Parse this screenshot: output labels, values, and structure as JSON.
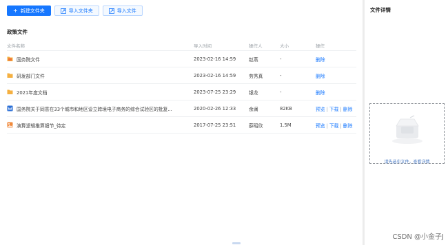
{
  "toolbar": {
    "new_folder": "新建文件夹",
    "import_folder": "导入文件夹",
    "import_file": "导入文件"
  },
  "section": {
    "title": "政策文件"
  },
  "table": {
    "headers": {
      "name": "文件名称",
      "time": "导入时间",
      "operator": "操作人",
      "size": "大小",
      "action": "操作"
    },
    "rows": [
      {
        "name": "国务院文件",
        "time": "2023-02-16 14:59",
        "operator": "赵燕",
        "size": "-",
        "icon": "folder-special-icon"
      },
      {
        "name": "研发部门文件",
        "time": "2023-02-16 14:59",
        "operator": "劳秀真",
        "size": "-",
        "icon": "folder-icon"
      },
      {
        "name": "2021年度文档",
        "time": "2023-07-25 23:29",
        "operator": "银龙",
        "size": "-",
        "icon": "folder-icon"
      },
      {
        "name": "国务院关于同意在33个城市和地区设立跨境电子商务的综合试验区的批复...",
        "time": "2020-02-26 12:33",
        "operator": "余澜",
        "size": "82KB",
        "icon": "word-doc-icon"
      },
      {
        "name": "演算逻辑推算细节_待定",
        "time": "2017-07-25 23:51",
        "operator": "薛昭欣",
        "size": "1.5M",
        "icon": "image-file-icon"
      }
    ],
    "actions": {
      "preview": "预览",
      "download": "下载",
      "delete": "删除",
      "separator": "|"
    }
  },
  "detail": {
    "title": "文件详情",
    "empty_text": "请先选中文件，查看详情"
  },
  "watermark": "CSDN @小金子J",
  "colors": {
    "primary": "#1677ff",
    "folder": "#f5b041",
    "word": "#2b6fd6"
  }
}
